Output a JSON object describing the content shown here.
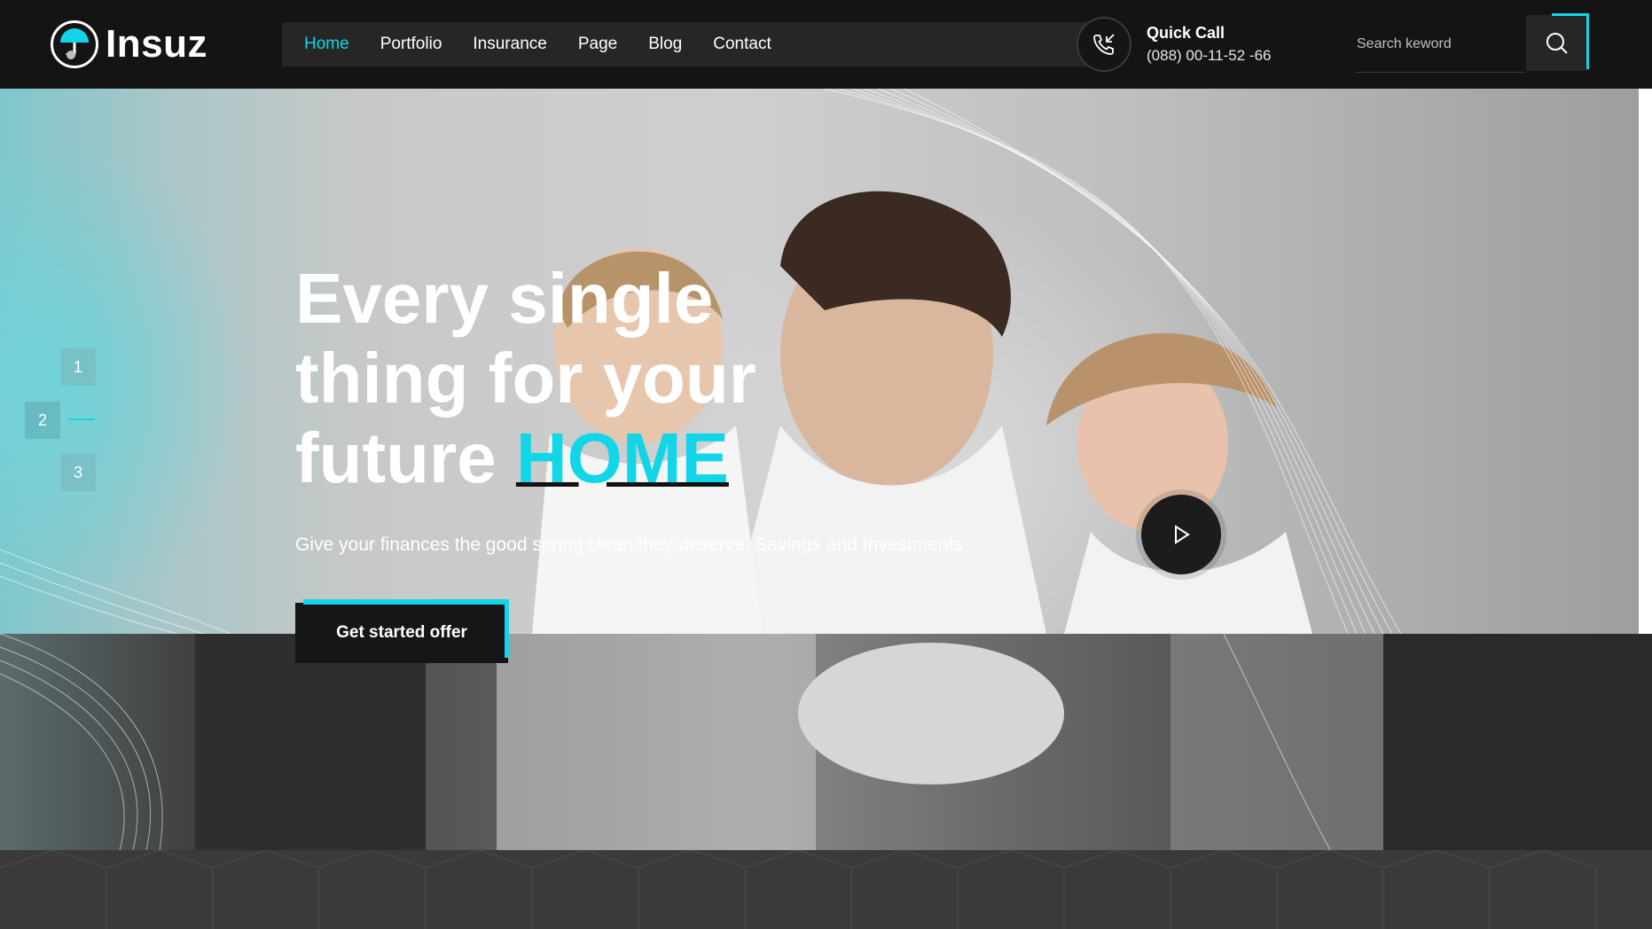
{
  "brand": {
    "name": "Insuz",
    "logo_icon": "umbrella-icon"
  },
  "nav": {
    "items": [
      {
        "label": "Home",
        "active": true
      },
      {
        "label": "Portfolio",
        "active": false
      },
      {
        "label": "Insurance",
        "active": false
      },
      {
        "label": "Page",
        "active": false
      },
      {
        "label": "Blog",
        "active": false
      },
      {
        "label": "Contact",
        "active": false
      }
    ]
  },
  "contact": {
    "icon": "phone-call-icon",
    "title": "Quick Call",
    "number": "(088) 00-11-52 -66"
  },
  "search": {
    "placeholder": "Search keword",
    "icon": "search-icon"
  },
  "hero": {
    "title_line1": "Every single",
    "title_line2": "thing for your",
    "title_line3": "future",
    "title_accent": "HOME",
    "subtitle": "Give your finances the good spring clean they deserve. Savings and Investments",
    "cta_label": "Get started offer",
    "play_icon": "play-icon",
    "slides": [
      "1",
      "2",
      "3"
    ],
    "active_slide": "2"
  },
  "colors": {
    "accent": "#12d5e8",
    "header_bg": "#141414",
    "nav_bg": "#262626"
  }
}
